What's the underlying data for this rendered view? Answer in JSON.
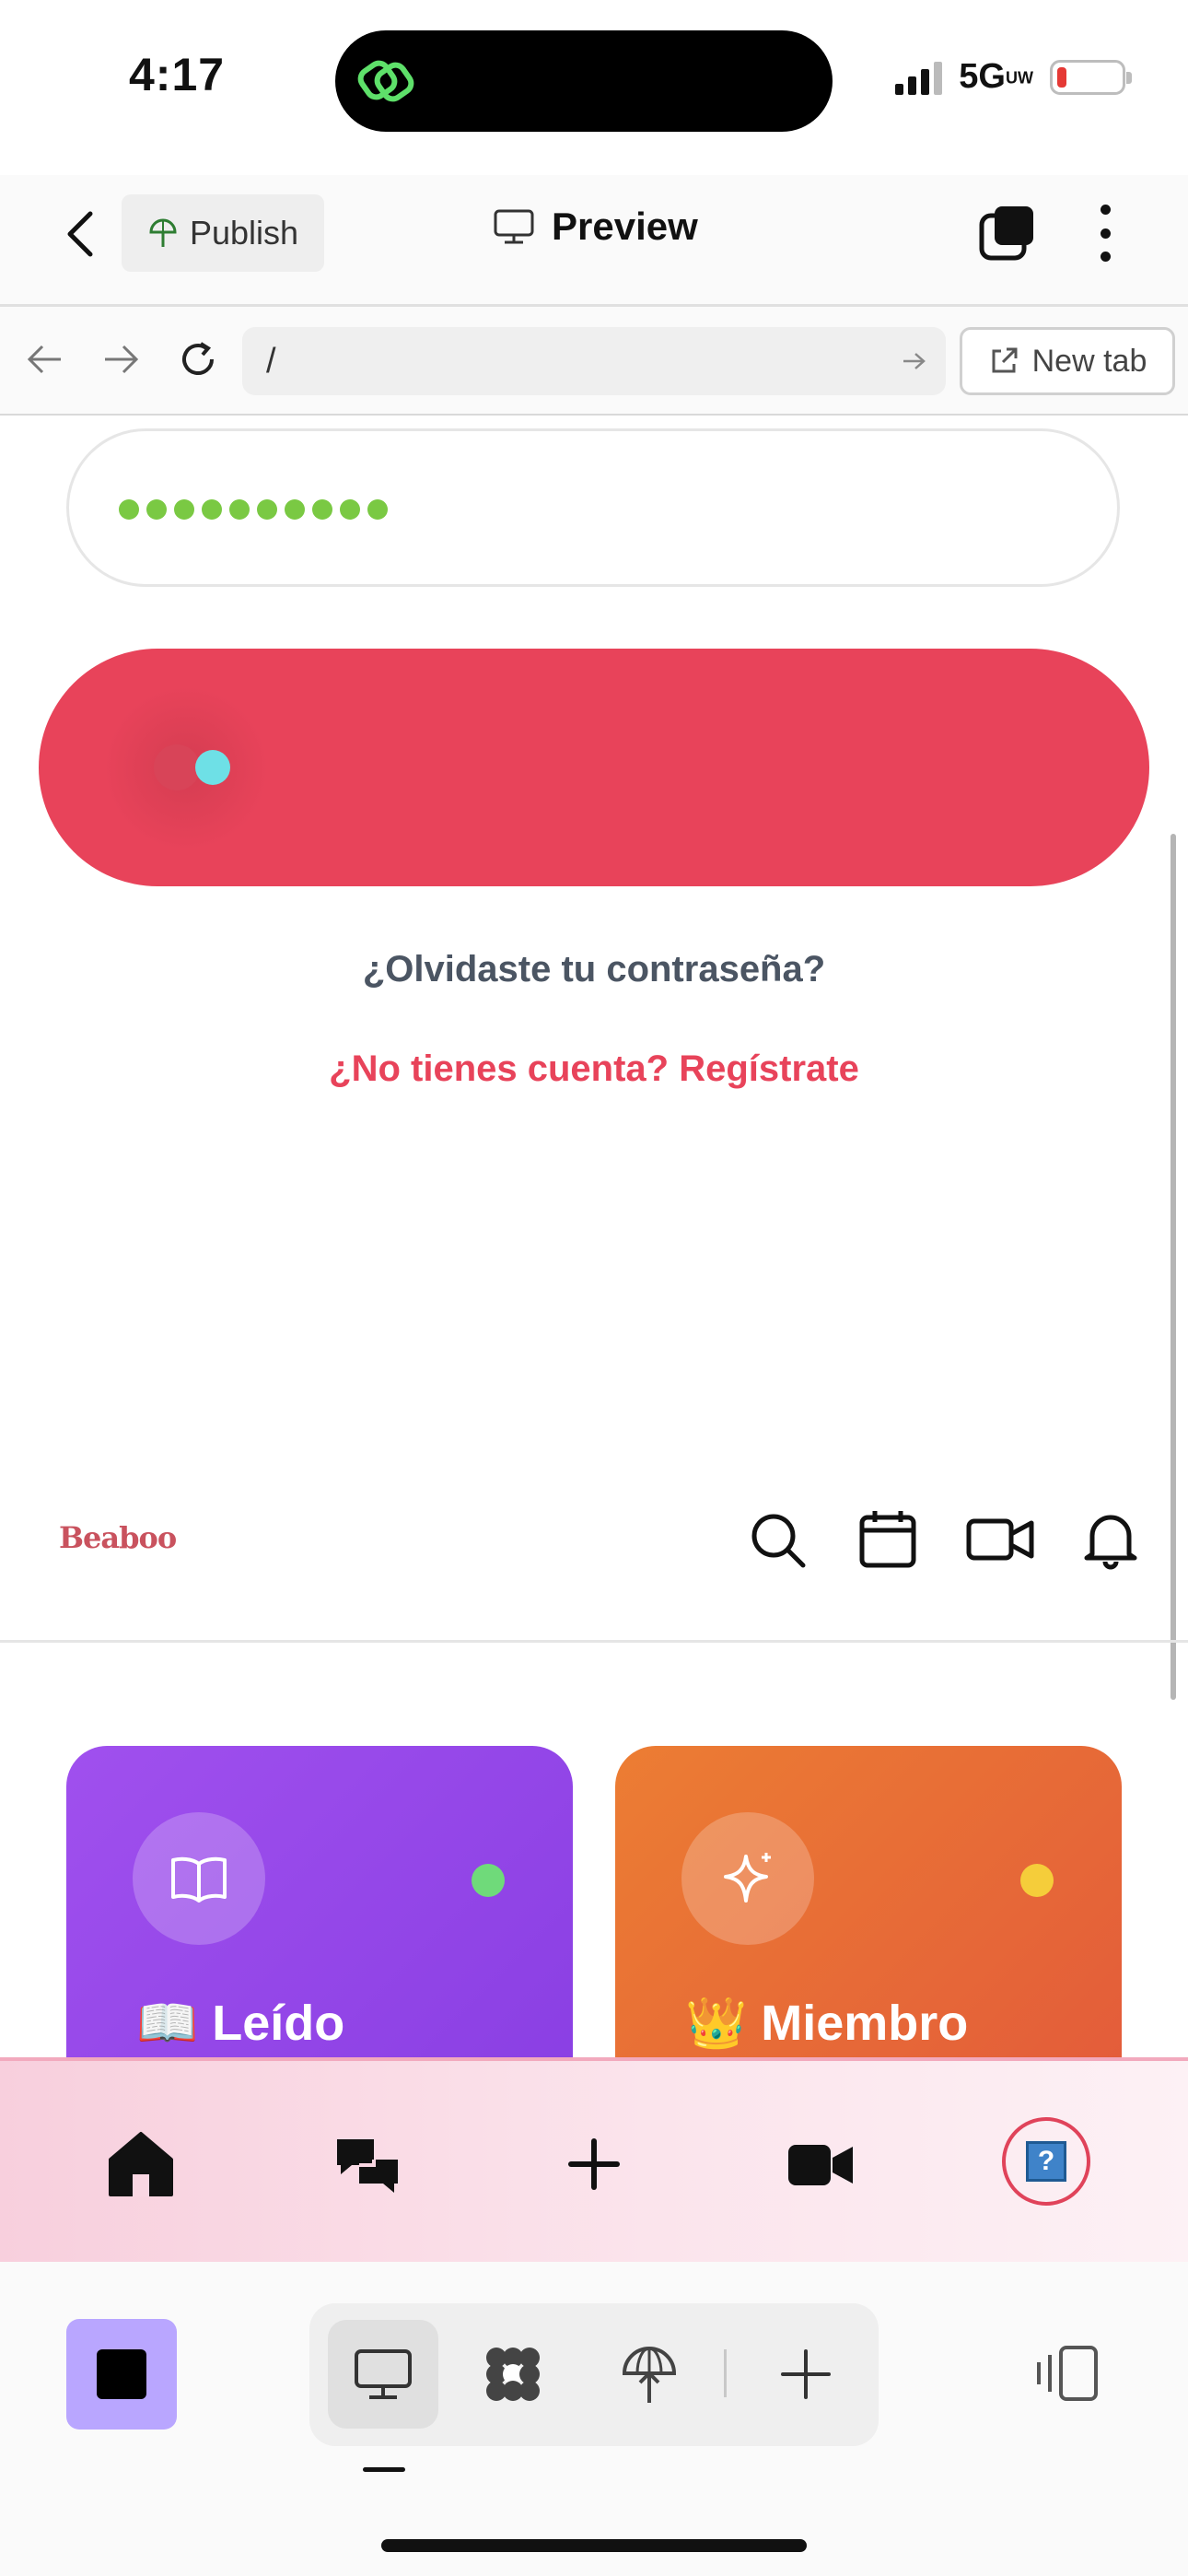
{
  "status_bar": {
    "time": "4:17",
    "network": "5G",
    "network_sub": "UW"
  },
  "topbar": {
    "publish_label": "Publish",
    "preview_label": "Preview"
  },
  "urlbar": {
    "url": "/",
    "new_tab_label": "New tab"
  },
  "login": {
    "password_masked": "●●●●●●●●●●",
    "forgot_password": "¿Olvidaste tu contraseña?",
    "register_prompt": "¿No tienes cuenta? Regístrate"
  },
  "app_header": {
    "brand_logo": "Beaboo"
  },
  "cards": [
    {
      "emoji": "📖",
      "title": "Leído",
      "status_color": "#6fda7a",
      "icon": "book-icon"
    },
    {
      "emoji": "👑",
      "title": "Miembro",
      "status_color": "#f5cd3a",
      "icon": "sparkles-icon"
    }
  ],
  "bottom_nav": {
    "items": [
      "home-icon",
      "chat-bubbles-icon",
      "plus-icon",
      "video-icon",
      "help-icon"
    ],
    "help_glyph": "?"
  },
  "colors": {
    "accent": "#e8435a",
    "purple_card": "#9b4cec",
    "orange_card": "#e86a35",
    "stop_button": "#b9a6ff"
  }
}
